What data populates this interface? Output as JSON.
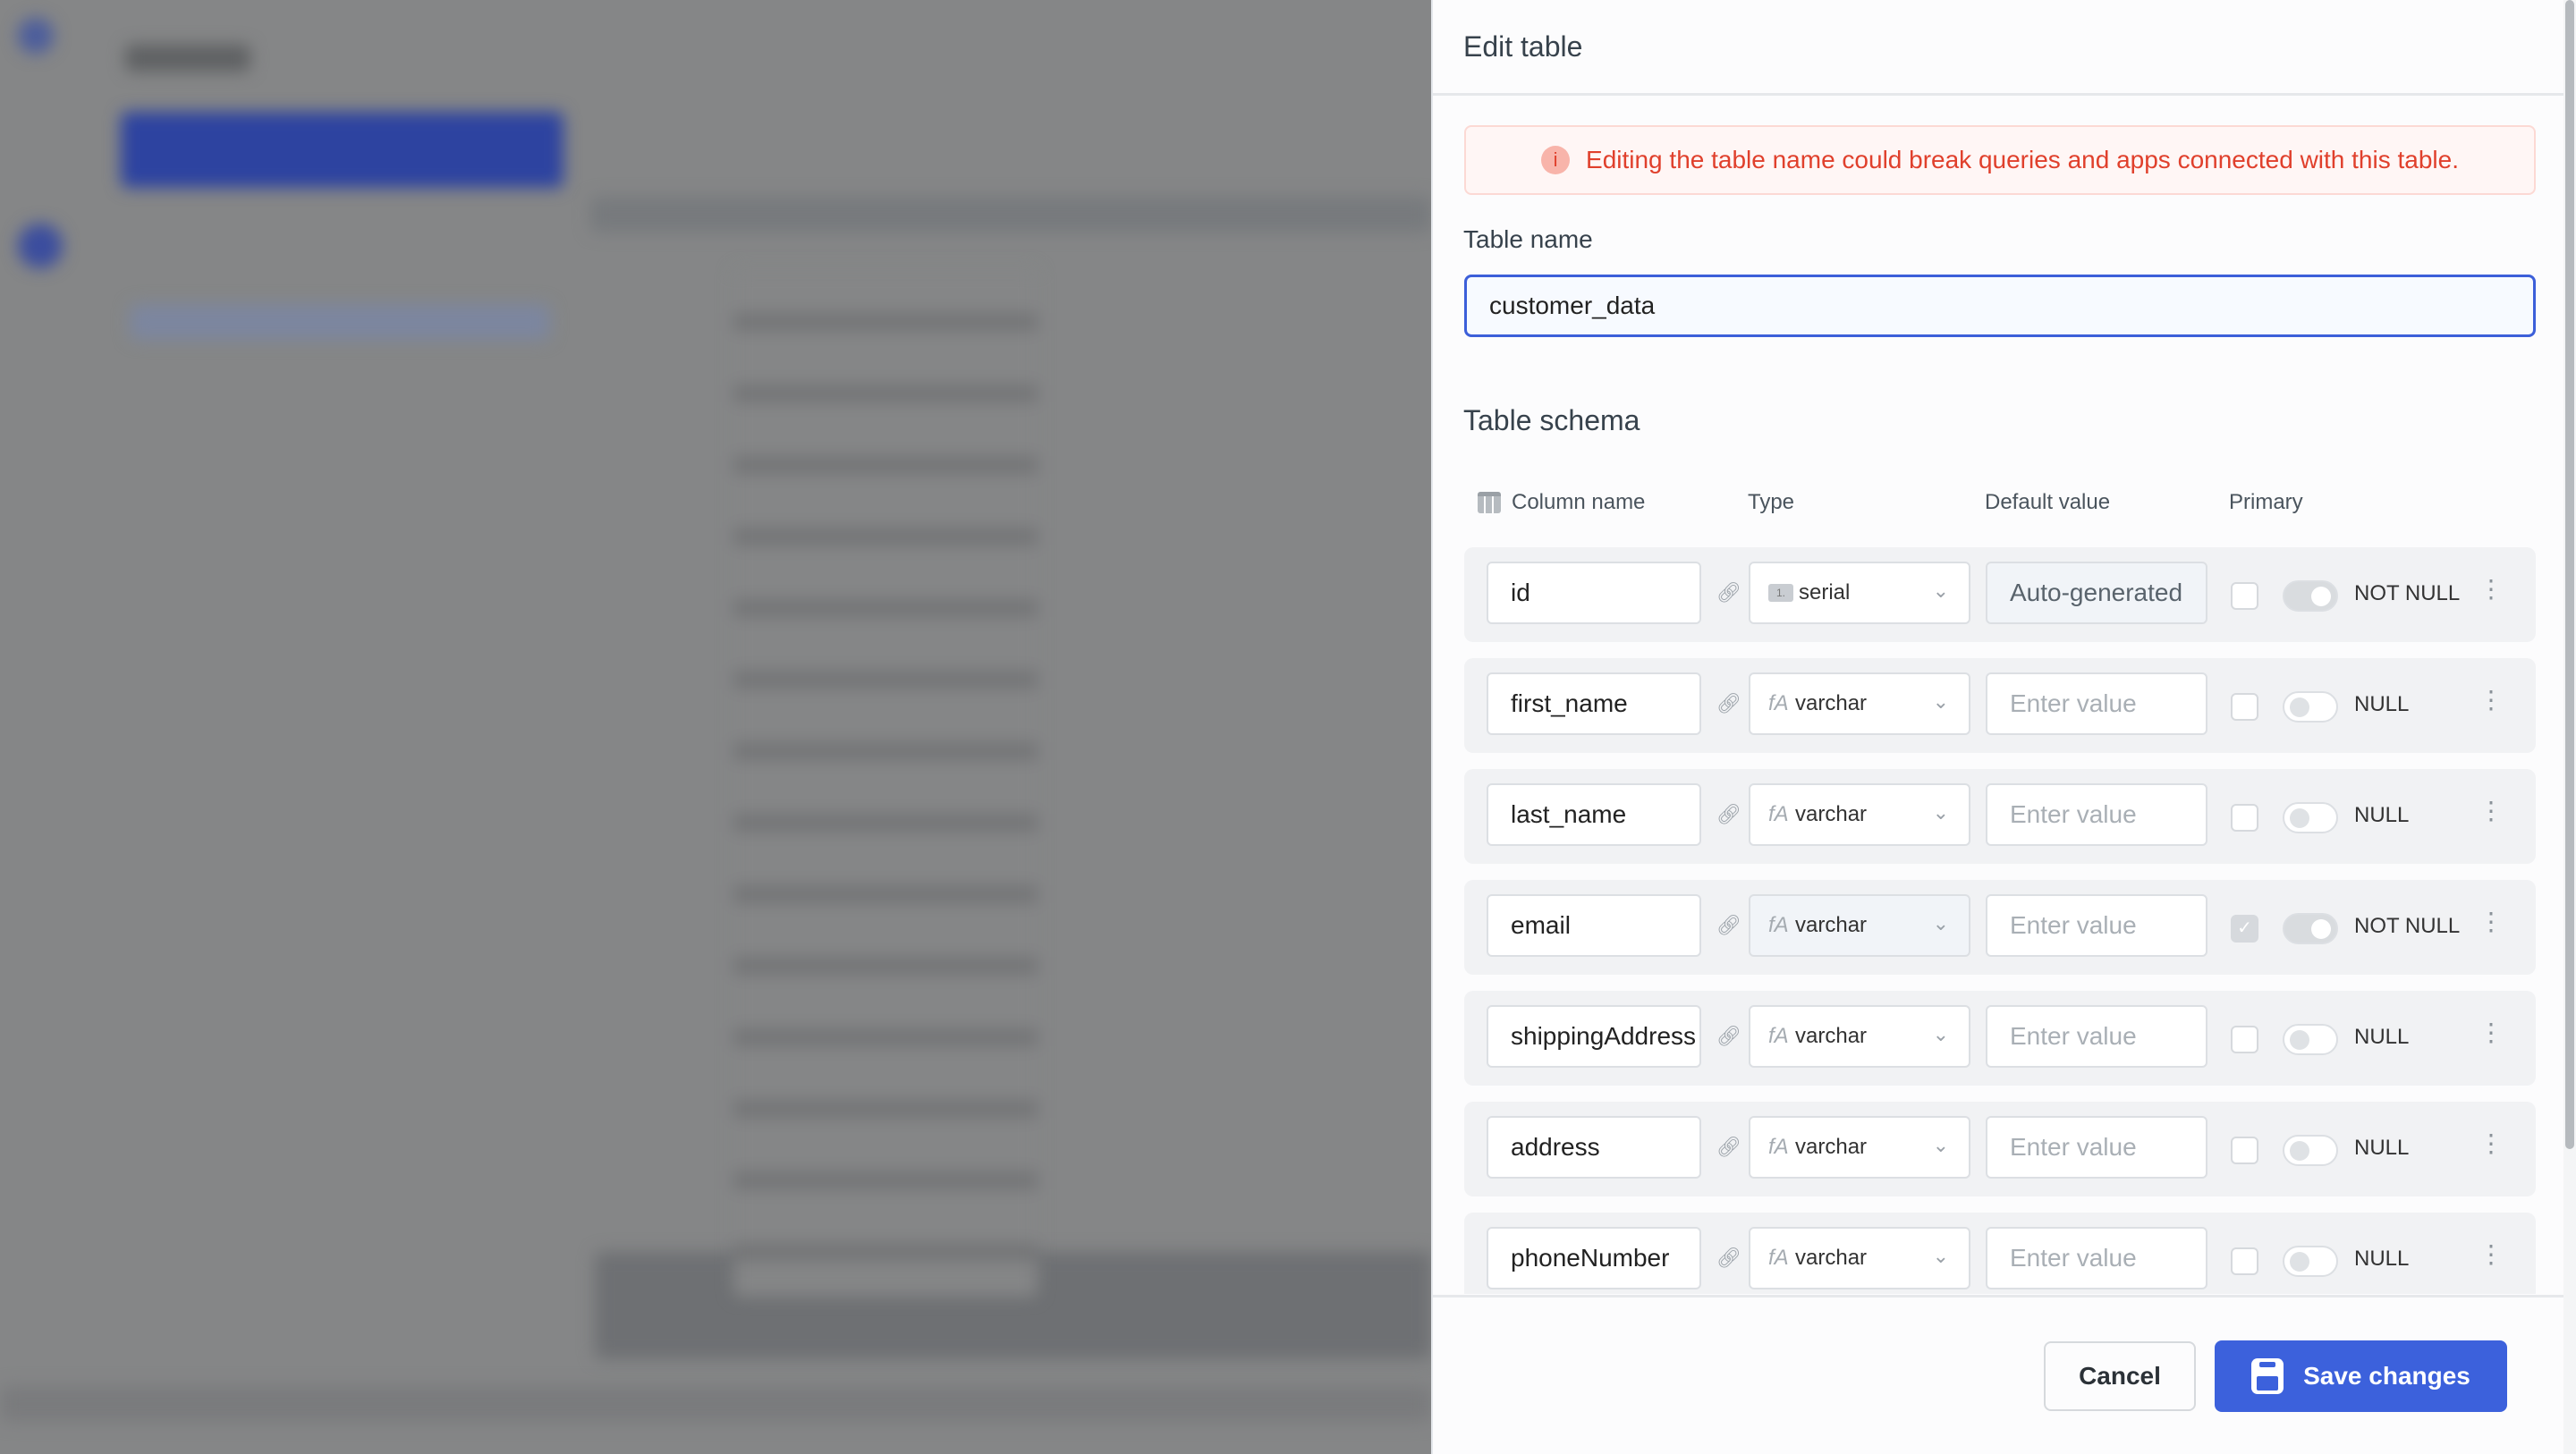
{
  "panel": {
    "title": "Edit table",
    "warning": "Editing the table name could break queries and apps connected with this table.",
    "table_name_label": "Table name",
    "table_name_value": "customer_data",
    "schema_title": "Table schema",
    "columns_header": {
      "name": "Column name",
      "type": "Type",
      "default": "Default value",
      "primary": "Primary"
    },
    "rows": [
      {
        "name": "id",
        "type": "serial",
        "type_icon": "1.",
        "default": "Auto-generated",
        "auto": true,
        "primary": false,
        "not_null": true,
        "null_label": "NOT NULL"
      },
      {
        "name": "first_name",
        "type": "varchar",
        "type_icon": "fA",
        "default": "Enter value",
        "auto": false,
        "primary": false,
        "not_null": false,
        "null_label": "NULL"
      },
      {
        "name": "last_name",
        "type": "varchar",
        "type_icon": "fA",
        "default": "Enter value",
        "auto": false,
        "primary": false,
        "not_null": false,
        "null_label": "NULL"
      },
      {
        "name": "email",
        "type": "varchar",
        "type_icon": "fA",
        "default": "Enter value",
        "auto": false,
        "primary": true,
        "not_null": true,
        "null_label": "NOT NULL"
      },
      {
        "name": "shippingAddress",
        "type": "varchar",
        "type_icon": "fA",
        "default": "Enter value",
        "auto": false,
        "primary": false,
        "not_null": false,
        "null_label": "NULL"
      },
      {
        "name": "address",
        "type": "varchar",
        "type_icon": "fA",
        "default": "Enter value",
        "auto": false,
        "primary": false,
        "not_null": false,
        "null_label": "NULL"
      },
      {
        "name": "phoneNumber",
        "type": "varchar",
        "type_icon": "fA",
        "default": "Enter value",
        "auto": false,
        "primary": false,
        "not_null": false,
        "null_label": "NULL"
      }
    ],
    "footer": {
      "cancel": "Cancel",
      "save": "Save changes"
    }
  },
  "colors": {
    "accent": "#3c61dc",
    "warning": "#e0402c"
  }
}
